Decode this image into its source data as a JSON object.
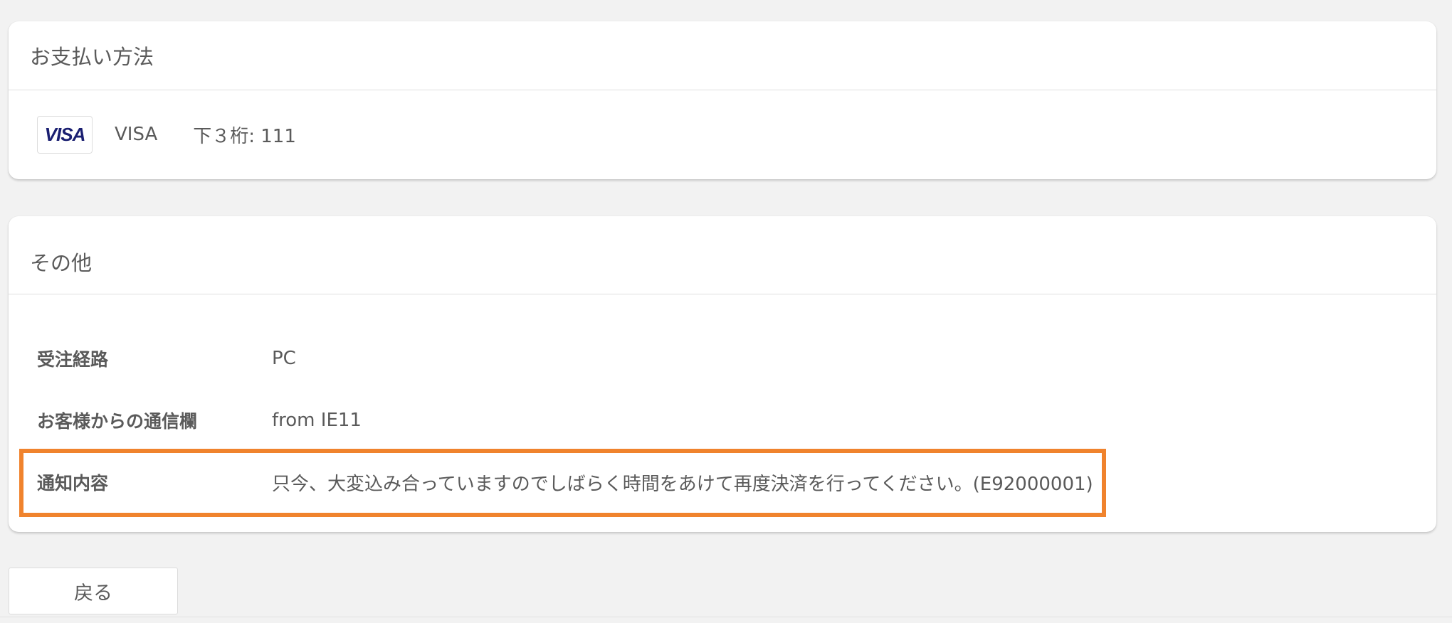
{
  "payment_section": {
    "title": "お支払い方法",
    "card_logo_text": "VISA",
    "card_brand": "VISA",
    "last_digits": "下３桁: 111"
  },
  "other_section": {
    "title": "その他",
    "rows": [
      {
        "label": "受注経路",
        "value": "PC"
      },
      {
        "label": "お客様からの通信欄",
        "value": "from IE11"
      },
      {
        "label": "通知内容",
        "value": "只今、大変込み合っていますのでしばらく時間をあけて再度決済を行ってください。(E92000001)"
      }
    ]
  },
  "actions": {
    "back_label": "戻る"
  },
  "colors": {
    "highlight": "#f0832d",
    "visa_blue": "#1a1f71",
    "background": "#f2f2f2"
  }
}
